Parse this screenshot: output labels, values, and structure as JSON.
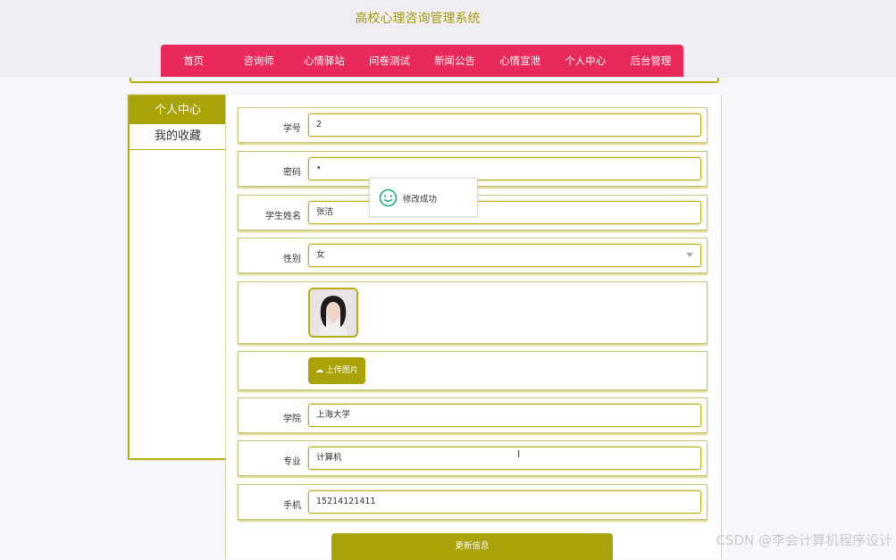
{
  "site": {
    "title": "高校心理咨询管理系统"
  },
  "nav": {
    "items": [
      {
        "label": "首页"
      },
      {
        "label": "咨询师"
      },
      {
        "label": "心情驿站"
      },
      {
        "label": "问卷测试"
      },
      {
        "label": "新闻公告"
      },
      {
        "label": "心情宣泄"
      },
      {
        "label": "个人中心"
      },
      {
        "label": "后台管理"
      }
    ],
    "color": "#e8295a"
  },
  "sidebar": {
    "items": [
      {
        "label": "个人中心",
        "active": true
      },
      {
        "label": "我的收藏",
        "active": false
      }
    ]
  },
  "form": {
    "student_id": {
      "label": "学号",
      "value": "2"
    },
    "password": {
      "label": "密码",
      "value": "•"
    },
    "name": {
      "label": "学生姓名",
      "value": "张洁"
    },
    "gender": {
      "label": "性别",
      "value": "女"
    },
    "upload_label": "上传图片",
    "college": {
      "label": "学院",
      "value": "上海大学"
    },
    "major": {
      "label": "专业",
      "value": "计算机"
    },
    "phone": {
      "label": "手机",
      "value": "15214121411"
    },
    "submit_label": "更新信息"
  },
  "toast": {
    "message": "修改成功"
  },
  "watermark": "CSDN @李会计算机程序设计",
  "theme": {
    "accent": "#a9a208",
    "border": "#b4ad14"
  }
}
